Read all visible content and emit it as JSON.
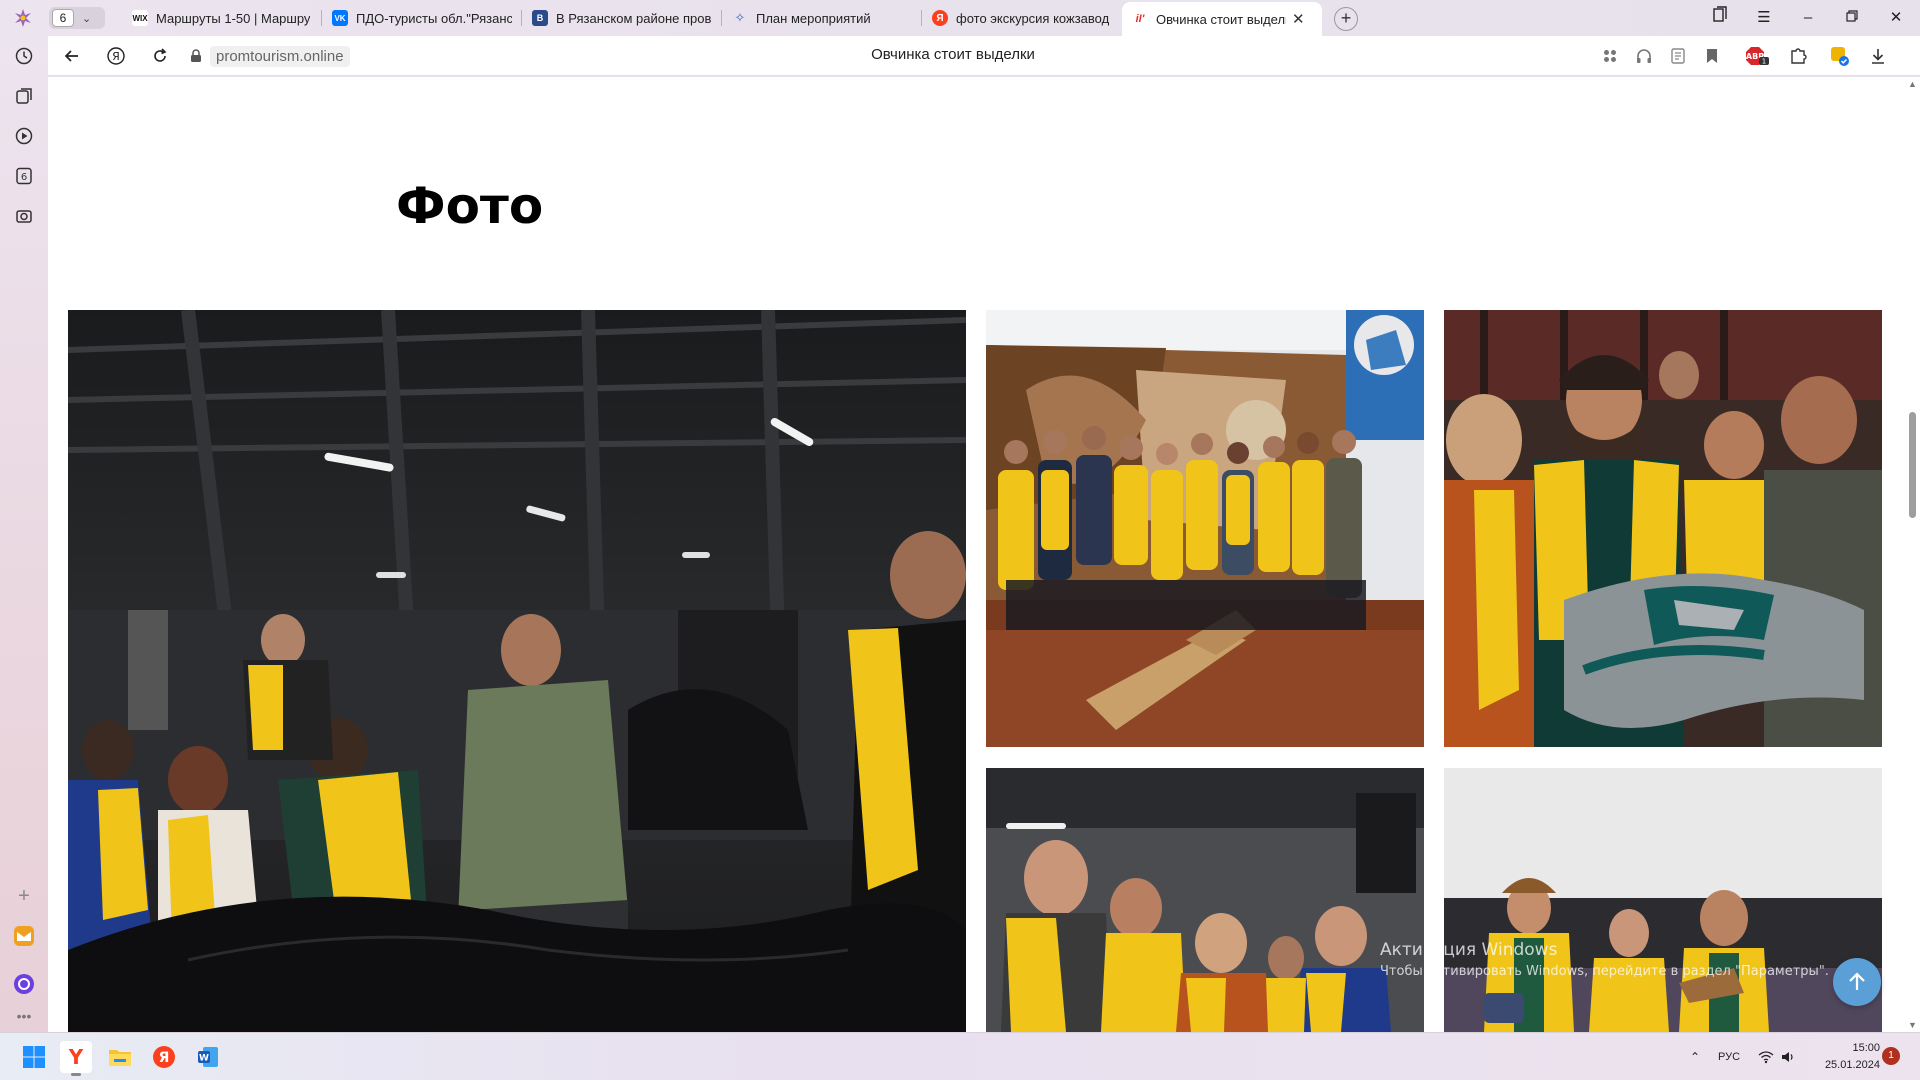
{
  "browser": {
    "tab_count": "6",
    "tabs": [
      {
        "favicon": "WIX",
        "title": "Маршруты 1-50 | Маршру"
      },
      {
        "favicon": "VK",
        "title": "ПДО-туристы обл.\"Рязанс"
      },
      {
        "favicon": "B",
        "title": "В Рязанском районе пров"
      },
      {
        "favicon": "✧",
        "title": "План мероприятий"
      },
      {
        "favicon": "Я",
        "title": "фото экскурсия кожзавод"
      },
      {
        "favicon": "iI'",
        "title": "Овчинка стоит выделки"
      }
    ],
    "active_tab_index": 5
  },
  "toolbar": {
    "url": "promtourism.online",
    "page_title": "Овчинка стоит выделки"
  },
  "page": {
    "heading": "Фото"
  },
  "windows_watermark": {
    "line1": "Активация Windows",
    "line2": "Чтобы активировать Windows, перейдите в раздел \"Параметры\"."
  },
  "taskbar": {
    "language": "РУС",
    "time": "15:00",
    "date": "25.01.2024",
    "notifications": "1"
  },
  "colors": {
    "vest_yellow": "#f0c419",
    "scroll_button": "#5aa0d6",
    "yandex_red": "#fc3f1d"
  }
}
